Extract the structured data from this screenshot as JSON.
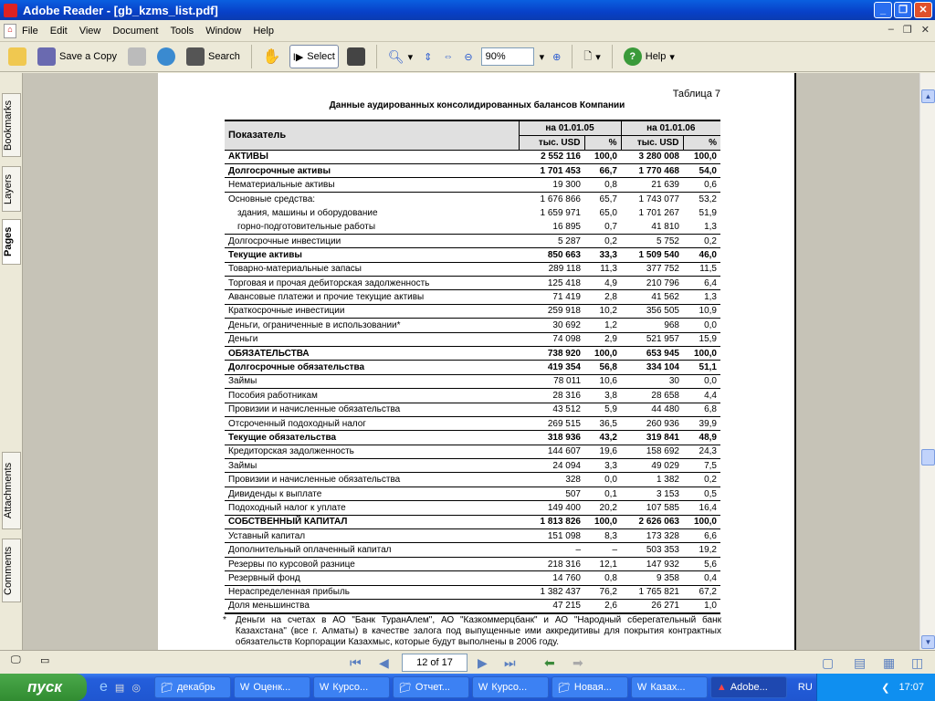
{
  "window": {
    "title": "Adobe Reader - [gb_kzms_list.pdf]"
  },
  "menu": [
    "File",
    "Edit",
    "View",
    "Document",
    "Tools",
    "Window",
    "Help"
  ],
  "toolbar": {
    "save_copy": "Save a Copy",
    "search": "Search",
    "select": "Select",
    "zoom": "90%",
    "help": "Help"
  },
  "left_tabs": [
    "Bookmarks",
    "Layers",
    "Pages",
    "Attachments",
    "Comments"
  ],
  "doc": {
    "table_num": "Таблица 7",
    "title": "Данные аудированных консолидированных балансов Компании",
    "header": {
      "label": "Показатель",
      "date1": "на 01.01.05",
      "date2": "на 01.01.06",
      "unit": "тыс. USD",
      "pct": "%"
    },
    "rows": [
      {
        "label": "АКТИВЫ",
        "v1": "2 552 116",
        "p1": "100,0",
        "v2": "3 280 008",
        "p2": "100,0",
        "bold": true
      },
      {
        "label": "Долгосрочные активы",
        "v1": "1 701 453",
        "p1": "66,7",
        "v2": "1 770 468",
        "p2": "54,0",
        "bold": true
      },
      {
        "label": "Нематериальные активы",
        "v1": "19 300",
        "p1": "0,8",
        "v2": "21 639",
        "p2": "0,6"
      },
      {
        "label": "Основные средства:",
        "v1": "1 676 866",
        "p1": "65,7",
        "v2": "1 743 077",
        "p2": "53,2",
        "nobl": true
      },
      {
        "label": "  здания, машины и оборудование",
        "v1": "1 659 971",
        "p1": "65,0",
        "v2": "1 701 267",
        "p2": "51,9",
        "nobl": true
      },
      {
        "label": "  горно-подготовительные работы",
        "v1": "16 895",
        "p1": "0,7",
        "v2": "41 810",
        "p2": "1,3"
      },
      {
        "label": "Долгосрочные инвестиции",
        "v1": "5 287",
        "p1": "0,2",
        "v2": "5 752",
        "p2": "0,2"
      },
      {
        "label": "Текущие активы",
        "v1": "850 663",
        "p1": "33,3",
        "v2": "1 509 540",
        "p2": "46,0",
        "bold": true
      },
      {
        "label": "Товарно-материальные запасы",
        "v1": "289 118",
        "p1": "11,3",
        "v2": "377 752",
        "p2": "11,5"
      },
      {
        "label": "Торговая и прочая дебиторская задолженность",
        "v1": "125 418",
        "p1": "4,9",
        "v2": "210 796",
        "p2": "6,4"
      },
      {
        "label": "Авансовые платежи и прочие текущие активы",
        "v1": "71 419",
        "p1": "2,8",
        "v2": "41 562",
        "p2": "1,3"
      },
      {
        "label": "Краткосрочные инвестиции",
        "v1": "259 918",
        "p1": "10,2",
        "v2": "356 505",
        "p2": "10,9"
      },
      {
        "label": "Деньги, ограниченные в использовании*",
        "v1": "30 692",
        "p1": "1,2",
        "v2": "968",
        "p2": "0,0"
      },
      {
        "label": "Деньги",
        "v1": "74 098",
        "p1": "2,9",
        "v2": "521 957",
        "p2": "15,9"
      },
      {
        "label": "ОБЯЗАТЕЛЬСТВА",
        "v1": "738 920",
        "p1": "100,0",
        "v2": "653 945",
        "p2": "100,0",
        "bold": true
      },
      {
        "label": "Долгосрочные обязательства",
        "v1": "419 354",
        "p1": "56,8",
        "v2": "334 104",
        "p2": "51,1",
        "bold": true
      },
      {
        "label": "Займы",
        "v1": "78 011",
        "p1": "10,6",
        "v2": "30",
        "p2": "0,0"
      },
      {
        "label": "Пособия работникам",
        "v1": "28 316",
        "p1": "3,8",
        "v2": "28 658",
        "p2": "4,4"
      },
      {
        "label": "Провизии и начисленные обязательства",
        "v1": "43 512",
        "p1": "5,9",
        "v2": "44 480",
        "p2": "6,8"
      },
      {
        "label": "Отсроченный подоходный налог",
        "v1": "269 515",
        "p1": "36,5",
        "v2": "260 936",
        "p2": "39,9"
      },
      {
        "label": "Текущие обязательства",
        "v1": "318 936",
        "p1": "43,2",
        "v2": "319 841",
        "p2": "48,9",
        "bold": true
      },
      {
        "label": "Кредиторская задолженность",
        "v1": "144 607",
        "p1": "19,6",
        "v2": "158 692",
        "p2": "24,3"
      },
      {
        "label": "Займы",
        "v1": "24 094",
        "p1": "3,3",
        "v2": "49 029",
        "p2": "7,5"
      },
      {
        "label": "Провизии и начисленные обязательства",
        "v1": "328",
        "p1": "0,0",
        "v2": "1 382",
        "p2": "0,2"
      },
      {
        "label": "Дивиденды к выплате",
        "v1": "507",
        "p1": "0,1",
        "v2": "3 153",
        "p2": "0,5"
      },
      {
        "label": "Подоходный налог к уплате",
        "v1": "149 400",
        "p1": "20,2",
        "v2": "107 585",
        "p2": "16,4"
      },
      {
        "label": "СОБСТВЕННЫЙ КАПИТАЛ",
        "v1": "1 813 826",
        "p1": "100,0",
        "v2": "2 626 063",
        "p2": "100,0",
        "bold": true
      },
      {
        "label": "Уставный капитал",
        "v1": "151 098",
        "p1": "8,3",
        "v2": "173 328",
        "p2": "6,6"
      },
      {
        "label": "Дополнительный оплаченный капитал",
        "v1": "–",
        "p1": "–",
        "v2": "503 353",
        "p2": "19,2"
      },
      {
        "label": "Резервы по курсовой разнице",
        "v1": "218 316",
        "p1": "12,1",
        "v2": "147 932",
        "p2": "5,6"
      },
      {
        "label": "Резервный фонд",
        "v1": "14 760",
        "p1": "0,8",
        "v2": "9 358",
        "p2": "0,4"
      },
      {
        "label": "Нераспределенная прибыль",
        "v1": "1 382 437",
        "p1": "76,2",
        "v2": "1 765 821",
        "p2": "67,2"
      },
      {
        "label": "Доля меньшинства",
        "v1": "47 215",
        "p1": "2,6",
        "v2": "26 271",
        "p2": "1,0",
        "last": true
      }
    ],
    "footnote_mark": "*",
    "footnote": "Деньги на счетах в АО \"Банк ТуранАлем\", АО \"Казкоммерцбанк\" и АО \"Народный сберегательный банк Казахстана\" (все г. Алматы) в качестве залога под выпущенные ими аккредитивы для покрытия контрактных обязательств Корпорации Казахмыс, которые будут выполнены в 2006 году."
  },
  "status": {
    "page": "12 of 17"
  },
  "taskbar": {
    "start": "пуск",
    "tasks": [
      "декабрь",
      "Оценк...",
      "Курсо...",
      "Отчет...",
      "Курсо...",
      "Новая...",
      "Казах...",
      "Adobe..."
    ],
    "lang": "RU",
    "time": "17:07"
  }
}
